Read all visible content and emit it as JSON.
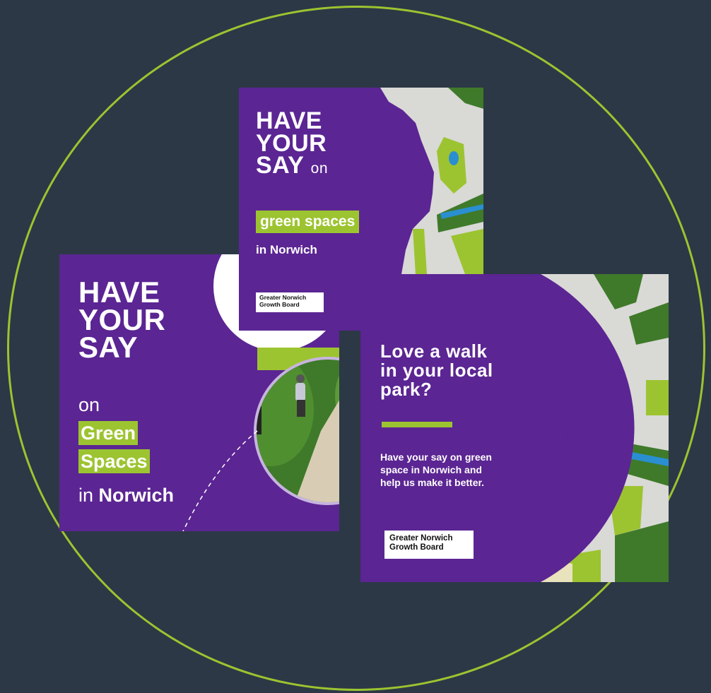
{
  "card_left": {
    "line1": "HAVE",
    "line2": "YOUR",
    "line3": "SAY",
    "on": "on",
    "green": "Green",
    "spaces": "Spaces",
    "in": "in",
    "norwich": "Norwich"
  },
  "card_top": {
    "line1": "HAVE",
    "line2": "YOUR",
    "line3": "SAY",
    "on": "on",
    "green_spaces": "green spaces",
    "in_norwich": "in Norwich",
    "logo_line1": "Greater Norwich",
    "logo_line2": "Growth Board"
  },
  "card_right": {
    "heading_line1": "Love a walk",
    "heading_line2": "in your local",
    "heading_line3": "park?",
    "body_line1": "Have your say on green",
    "body_line2": "space in Norwich and",
    "body_line3": "help us make it better.",
    "logo_line1": "Greater Norwich",
    "logo_line2": "Growth Board"
  },
  "colors": {
    "background": "#2c3846",
    "purple": "#5b2593",
    "green": "#9cc430",
    "map_grey": "#d9d9d6",
    "water": "#2a8fd0"
  }
}
